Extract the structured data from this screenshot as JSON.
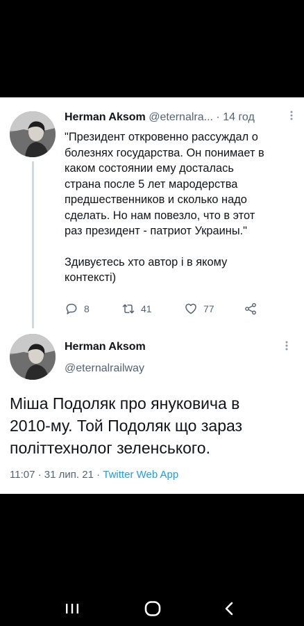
{
  "tweet1": {
    "author_name": "Herman Aksom",
    "handle": "@eternalra...",
    "separator": "·",
    "time": "14 год",
    "more_icon": "more-vertical-icon",
    "lines": [
      "\"Президент откровенно рассуждал о",
      "болезнях государства. Он понимает в",
      "каком состоянии ему досталась",
      "страна после 5 лет мародерства",
      "предшественников и сколько надо",
      "сделать. Но нам повезло, что в этот",
      "раз президент - патриот Украины.\""
    ],
    "lines2": [
      "Здивуєтесь хто автор і в якому",
      "контексті)"
    ],
    "actions": {
      "reply_count": "8",
      "retweet_count": "41",
      "like_count": "77"
    }
  },
  "tweet2": {
    "author_name": "Herman Aksom",
    "handle": "@eternalrailway",
    "more_icon": "more-vertical-icon",
    "lines": [
      "Міша Подоляк про януковича в",
      "2010-му. Той Подоляк що зараз",
      "політтехнолог зеленського."
    ],
    "time": "11:07",
    "date": "31 лип. 21",
    "source": "Twitter Web App",
    "separator": "·"
  },
  "nav": {
    "recent_icon": "recent-apps-icon",
    "home_icon": "home-icon",
    "back_icon": "back-icon"
  },
  "colors": {
    "text": "#0f1419",
    "secondary": "#536471",
    "link": "#1d9bf0",
    "thread_line": "#cfd9de"
  }
}
